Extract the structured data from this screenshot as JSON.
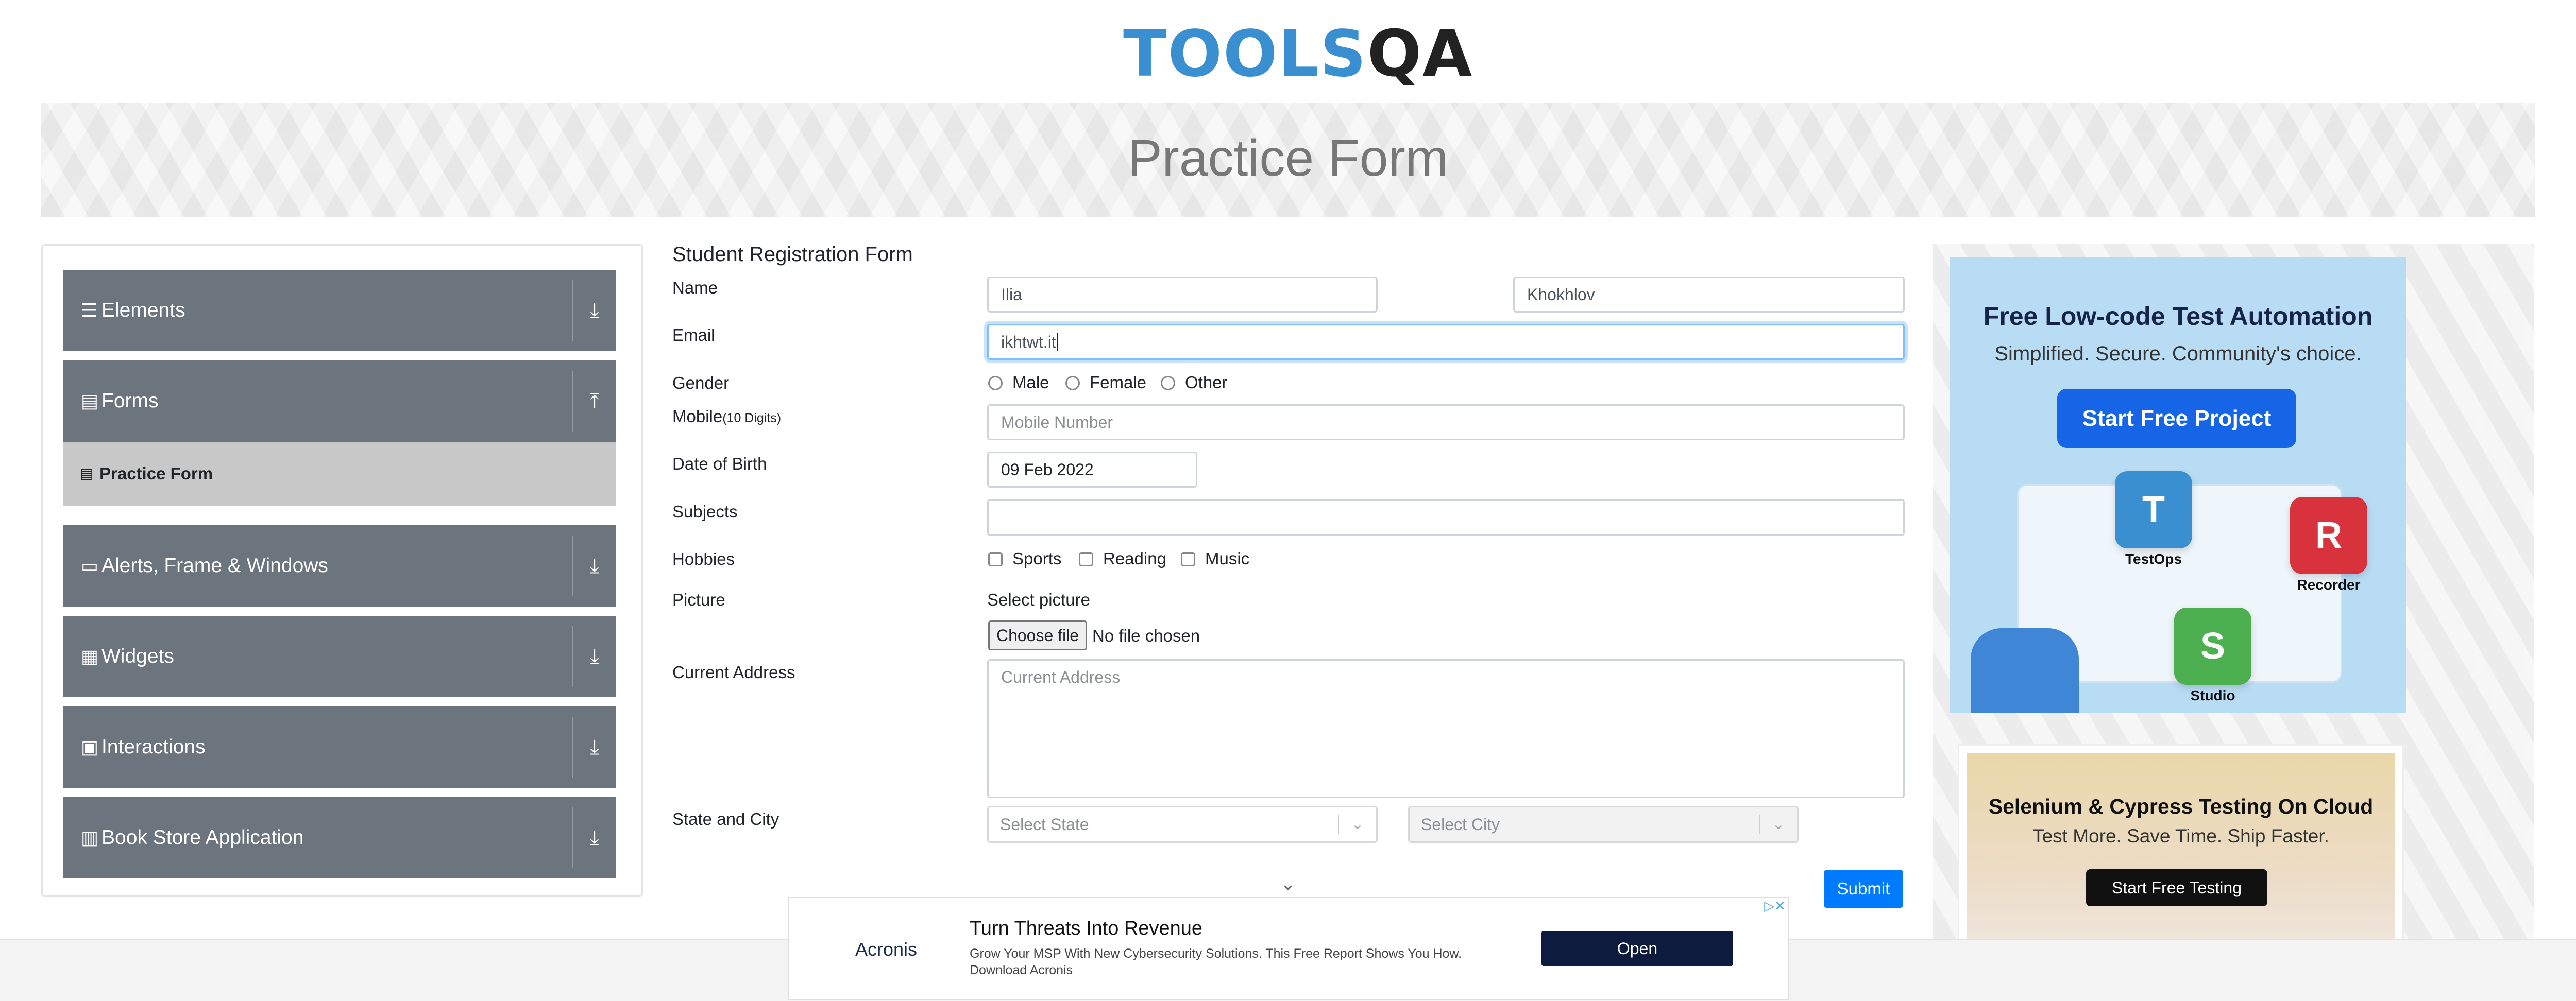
{
  "logo": {
    "part1": "TOOLS",
    "part2": "QA"
  },
  "banner": {
    "title": "Practice Form"
  },
  "sidebar": {
    "groups": [
      {
        "label": "Elements",
        "icon": "hamburger-icon",
        "icon_char": "☰",
        "arrow_char": "⤓"
      },
      {
        "label": "Forms",
        "icon": "document-icon",
        "icon_char": "▤",
        "arrow_char": "⤒"
      },
      {
        "label": "Alerts, Frame & Windows",
        "icon": "window-icon",
        "icon_char": "▭",
        "arrow_char": "⤓"
      },
      {
        "label": "Widgets",
        "icon": "grid-icon",
        "icon_char": "▦",
        "arrow_char": "⤓"
      },
      {
        "label": "Interactions",
        "icon": "interaction-icon",
        "icon_char": "▣",
        "arrow_char": "⤓"
      },
      {
        "label": "Book Store Application",
        "icon": "book-icon",
        "icon_char": "▥",
        "arrow_char": "⤓"
      }
    ],
    "active_item": {
      "label": "Practice Form",
      "icon_char": "▤"
    }
  },
  "form": {
    "title": "Student Registration Form",
    "name_label": "Name",
    "first_name": "Ilia",
    "last_name": "Khokhlov",
    "email_label": "Email",
    "email_value": "ikhtwt.it",
    "gender_label": "Gender",
    "gender_options": [
      "Male",
      "Female",
      "Other"
    ],
    "mobile_label": "Mobile",
    "mobile_hint": "(10 Digits)",
    "mobile_placeholder": "Mobile Number",
    "dob_label": "Date of Birth",
    "dob_value": "09 Feb 2022",
    "subjects_label": "Subjects",
    "hobbies_label": "Hobbies",
    "hobbies_options": [
      "Sports",
      "Reading",
      "Music"
    ],
    "picture_label": "Picture",
    "select_picture": "Select picture",
    "choose_file": "Choose file",
    "no_file": "No file chosen",
    "address_label": "Current Address",
    "address_placeholder": "Current Address",
    "state_city_label": "State and City",
    "state_placeholder": "Select State",
    "city_placeholder": "Select City",
    "submit": "Submit"
  },
  "ads": {
    "katalon": {
      "headline": "Free Low-code Test Automation",
      "sub": "Simplified. Secure. Community's choice.",
      "cta": "Start Free Project",
      "tiles": [
        {
          "letter": "T",
          "label": "TestOps",
          "color": "#3a8fd0"
        },
        {
          "letter": "R",
          "label": "Recorder",
          "color": "#d8323c"
        },
        {
          "letter": "S",
          "label": "Studio",
          "color": "#4caf50"
        }
      ]
    },
    "cloud": {
      "headline": "Selenium & Cypress Testing On Cloud",
      "sub": "Test More. Save Time. Ship Faster.",
      "cta": "Start Free Testing"
    },
    "bottom": {
      "brand": "Acronis",
      "headline": "Turn Threats Into Revenue",
      "desc": "Grow Your MSP With New Cybersecurity Solutions. This Free Report Shows You How. Download Acronis",
      "cta": "Open",
      "close": "▷✕"
    }
  }
}
